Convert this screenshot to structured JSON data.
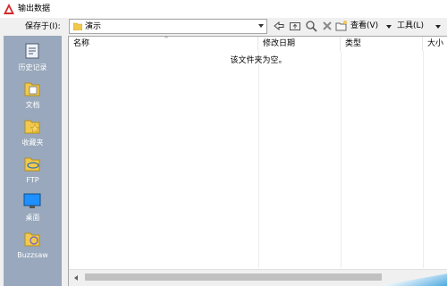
{
  "window": {
    "title": "输出数据"
  },
  "toolbar": {
    "save_in_label": "保存于(I):",
    "location_value": "演示",
    "view_label": "查看(V)",
    "tools_label": "工具(L)"
  },
  "places": [
    {
      "label": "历史记录",
      "icon": "history-icon"
    },
    {
      "label": "文档",
      "icon": "documents-icon"
    },
    {
      "label": "收藏夹",
      "icon": "favorites-icon"
    },
    {
      "label": "FTP",
      "icon": "ftp-icon"
    },
    {
      "label": "桌面",
      "icon": "desktop-icon"
    },
    {
      "label": "Buzzsaw",
      "icon": "buzzsaw-icon"
    }
  ],
  "filelist": {
    "columns": [
      "名称",
      "修改日期",
      "类型",
      "大小"
    ],
    "empty_message": "该文件夹为空。"
  },
  "colors": {
    "places_bg": "#99a8bc",
    "accent": "#4aa8e0"
  }
}
